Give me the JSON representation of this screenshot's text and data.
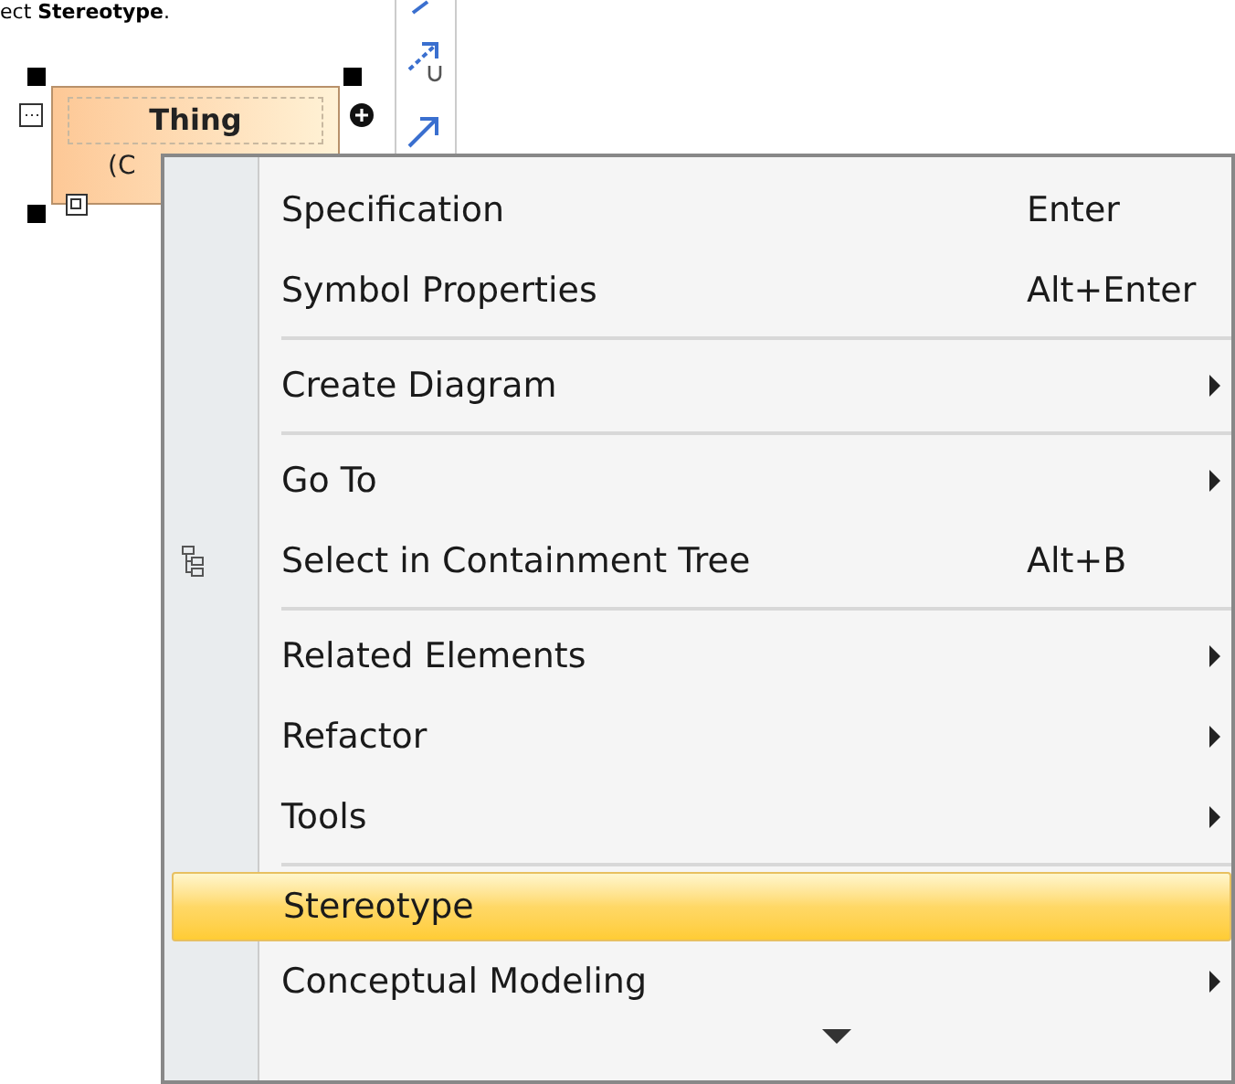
{
  "caption": "ect **Stereotype**.",
  "diagram": {
    "element": {
      "name": "Thing",
      "type_label": "(C"
    }
  },
  "context_menu": {
    "items": [
      {
        "kind": "item",
        "label": "Specification",
        "shortcut": "Enter",
        "submenu": false,
        "selected": false
      },
      {
        "kind": "item",
        "label": "Symbol Properties",
        "shortcut": "Alt+Enter",
        "submenu": false,
        "selected": false
      },
      {
        "kind": "separator"
      },
      {
        "kind": "item",
        "label": "Create Diagram",
        "submenu": true,
        "selected": false
      },
      {
        "kind": "separator"
      },
      {
        "kind": "item",
        "label": "Go To",
        "submenu": true,
        "selected": false
      },
      {
        "kind": "locate",
        "label": "Select in Containment Tree",
        "shortcut": "Alt+B",
        "submenu": false,
        "selected": false
      },
      {
        "kind": "separator"
      },
      {
        "kind": "item",
        "label": "Related Elements",
        "submenu": true,
        "selected": false
      },
      {
        "kind": "item",
        "label": "Refactor",
        "submenu": true,
        "selected": false
      },
      {
        "kind": "item",
        "label": "Tools",
        "submenu": true,
        "selected": false
      },
      {
        "kind": "separator"
      },
      {
        "kind": "item",
        "label": "Stereotype",
        "submenu": false,
        "selected": true
      },
      {
        "kind": "item",
        "label": "Conceptual Modeling",
        "submenu": true,
        "selected": false
      },
      {
        "kind": "more"
      }
    ]
  }
}
